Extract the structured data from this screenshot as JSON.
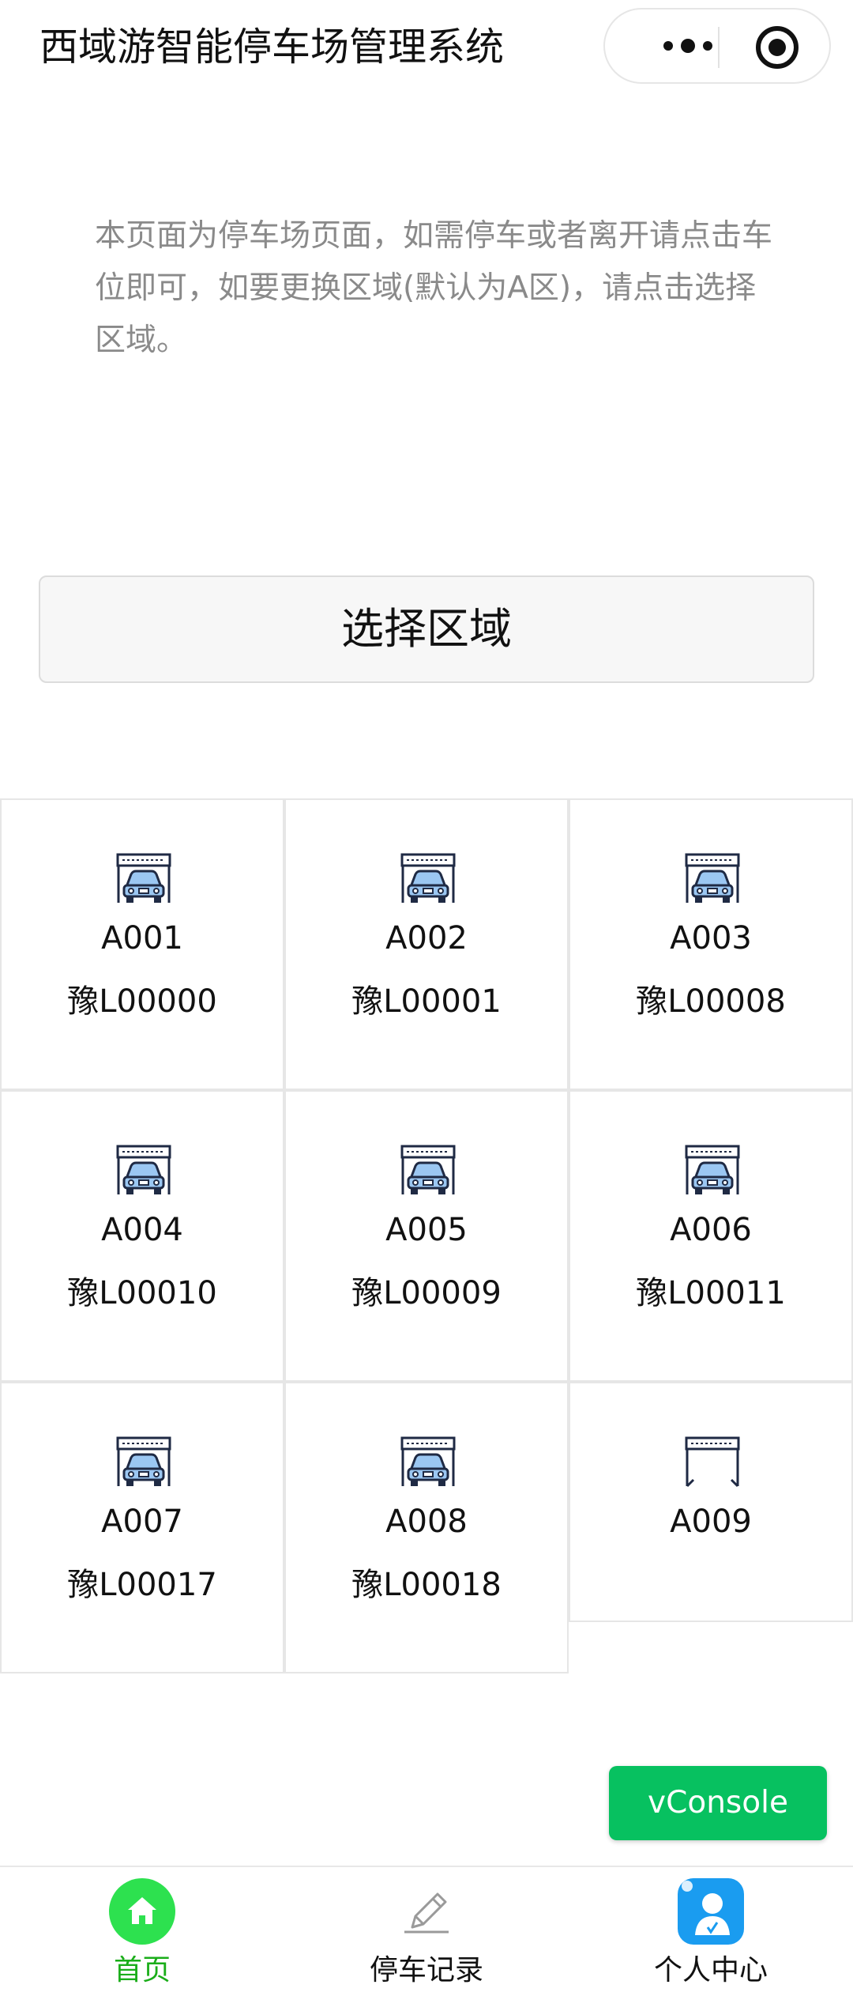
{
  "header": {
    "title": "西域游智能停车场管理系统",
    "more_icon": "more-dots-icon",
    "close_icon": "target-circle-icon"
  },
  "intro": {
    "text": "本页面为停车场页面，如需停车或者离开请点击车位即可，如要更换区域(默认为A区)，请点击选择区域。"
  },
  "select_area": {
    "label": "选择区域"
  },
  "parking": {
    "spots": [
      {
        "code": "A001",
        "plate": "豫L00000",
        "occupied": true
      },
      {
        "code": "A002",
        "plate": "豫L00001",
        "occupied": true
      },
      {
        "code": "A003",
        "plate": "豫L00008",
        "occupied": true
      },
      {
        "code": "A004",
        "plate": "豫L00010",
        "occupied": true
      },
      {
        "code": "A005",
        "plate": "豫L00009",
        "occupied": true
      },
      {
        "code": "A006",
        "plate": "豫L00011",
        "occupied": true
      },
      {
        "code": "A007",
        "plate": "豫L00017",
        "occupied": true
      },
      {
        "code": "A008",
        "plate": "豫L00018",
        "occupied": true
      },
      {
        "code": "A009",
        "plate": "",
        "occupied": false
      }
    ]
  },
  "vconsole": {
    "label": "vConsole",
    "color": "#07c160"
  },
  "tabbar": {
    "tabs": [
      {
        "label": "首页",
        "icon": "home-icon",
        "active": true
      },
      {
        "label": "停车记录",
        "icon": "pencil-icon",
        "active": false
      },
      {
        "label": "个人中心",
        "icon": "user-avatar-icon",
        "active": false
      }
    ],
    "active_color": "#1aad19"
  }
}
